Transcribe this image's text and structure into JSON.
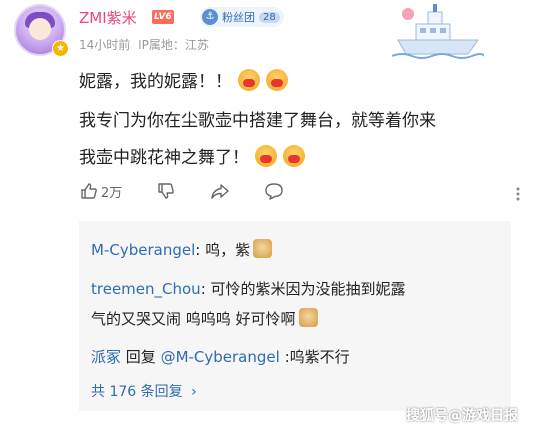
{
  "comment": {
    "username": "ZMI紫米",
    "level_badge": "LV6",
    "fan_badge_label": "粉丝团",
    "fan_badge_count": "28",
    "time": "14小时前",
    "ip_location": "IP属地：江苏",
    "text_line1": "妮露，我的妮露！！",
    "text_line2": "我专门为你在尘歌壶中搭建了舞台，就等着你来",
    "text_line3": "我壶中跳花神之舞了！",
    "like_count": "2万"
  },
  "replies": [
    {
      "author": "M-Cyberangel",
      "text": ": 呜，紫"
    },
    {
      "author": "treemen_Chou",
      "text": ": 可怜的紫米因为没能抽到妮露",
      "text2": "气的又哭又闹 呜呜呜 好可怜啊"
    },
    {
      "author": "派冢",
      "text": " 回复 ",
      "mention": "@M-Cyberangel",
      "text_after": " :呜紫不行"
    }
  ],
  "total_replies": "共 176 条回复",
  "watermark": "搜狐号@游戏日报",
  "icons": [
    "crown-icon",
    "fan-group-icon",
    "like-icon",
    "dislike-icon",
    "share-icon",
    "comment-icon",
    "more-icon",
    "chevron-right-icon"
  ],
  "colors": {
    "username": "#e8467c",
    "link": "#2f6bb3",
    "level": "#ff6b5a",
    "reply_bg": "#f6f6f6"
  }
}
